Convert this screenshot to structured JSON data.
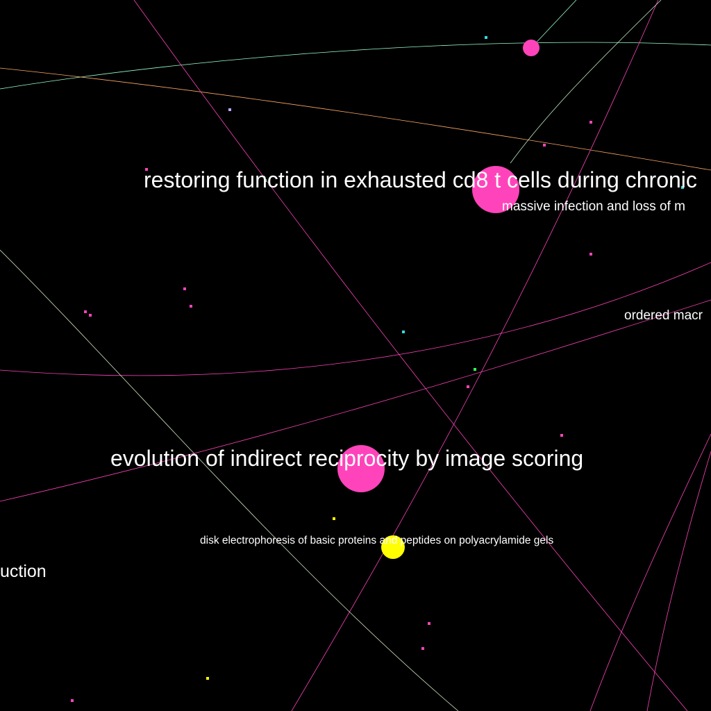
{
  "labels": {
    "restoring": "restoring function in exhausted cd8 t cells during chronic",
    "massive": "massive infection and loss of m",
    "ordered": "ordered macr",
    "evolution": "evolution of indirect reciprocity by image scoring",
    "disk": "disk electrophoresis of basic proteins and peptides on polyacrylamide gels",
    "uction": "uction"
  },
  "colors": {
    "background": "#000000",
    "magenta": "#ff44bb",
    "yellow": "#ffff00",
    "cyan": "#33dddd",
    "green": "#33ff55",
    "lavender": "#bbaaff",
    "orange": "#ffaa66",
    "mint": "#99ffcc",
    "label": "#ffffff"
  },
  "icons": {
    "node": "circle-node",
    "edge": "curved-edge"
  }
}
